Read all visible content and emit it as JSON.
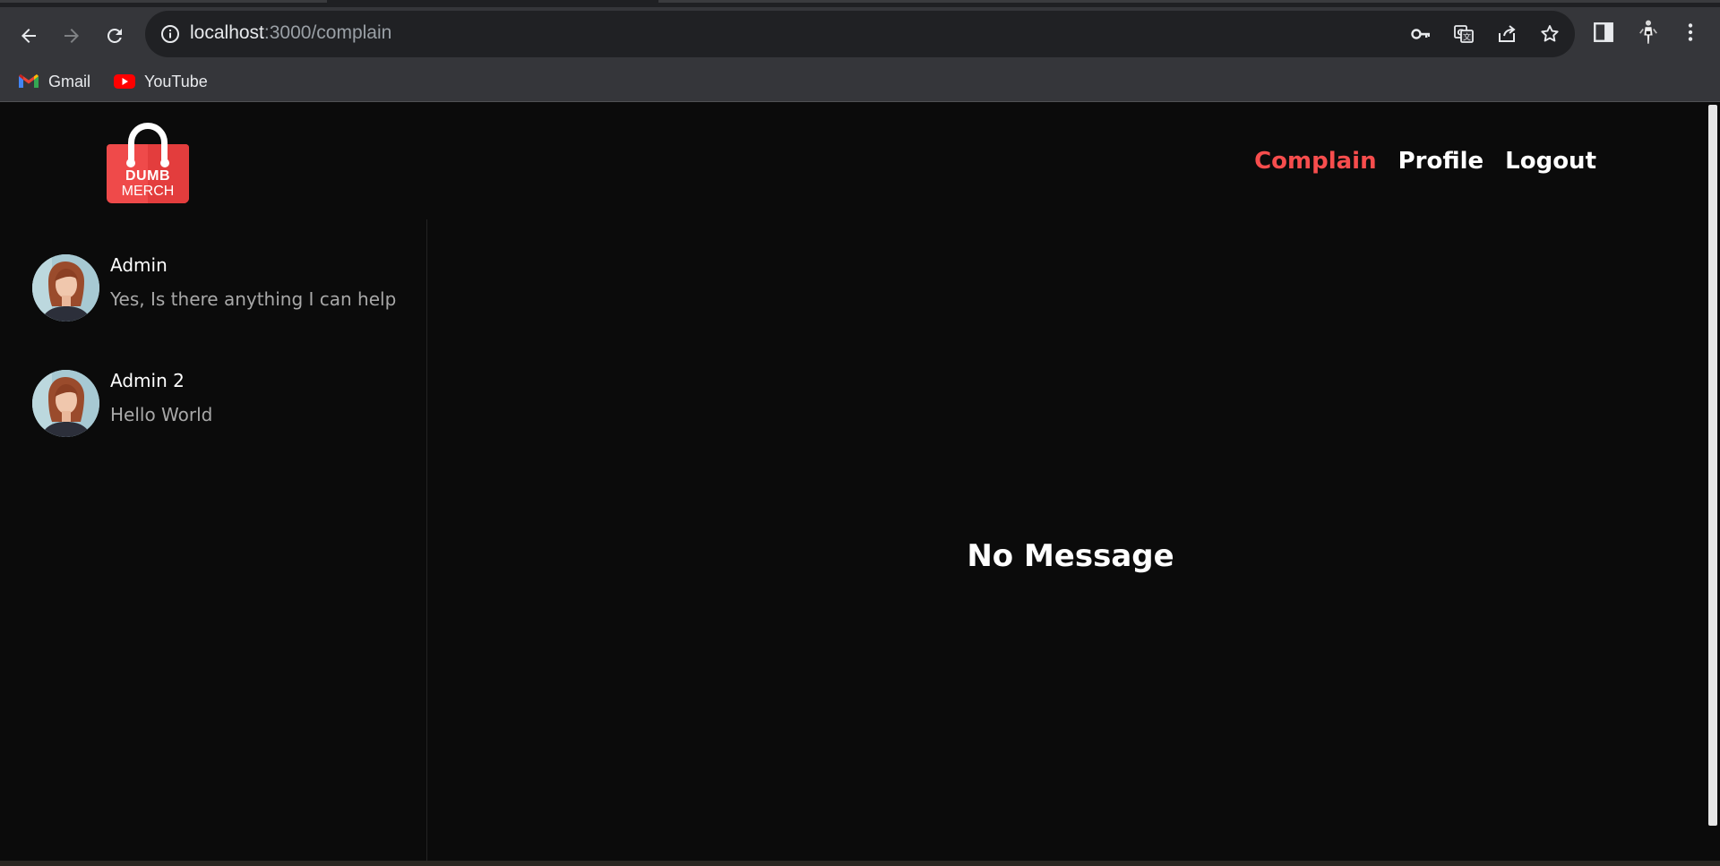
{
  "browser": {
    "url_host": "localhost",
    "url_path": ":3000/complain",
    "bookmarks": [
      {
        "label": "Gmail",
        "icon": "gmail-icon"
      },
      {
        "label": "YouTube",
        "icon": "youtube-icon"
      }
    ]
  },
  "app": {
    "logo_line1": "DUMB",
    "logo_line2": "MERCH",
    "nav": {
      "complain": "Complain",
      "profile": "Profile",
      "logout": "Logout"
    },
    "accent_color": "#f74d4d"
  },
  "contacts": [
    {
      "name": "Admin",
      "last_message": "Yes, Is there anything I can help"
    },
    {
      "name": "Admin 2",
      "last_message": "Hello World"
    }
  ],
  "chat": {
    "empty_text": "No Message"
  }
}
